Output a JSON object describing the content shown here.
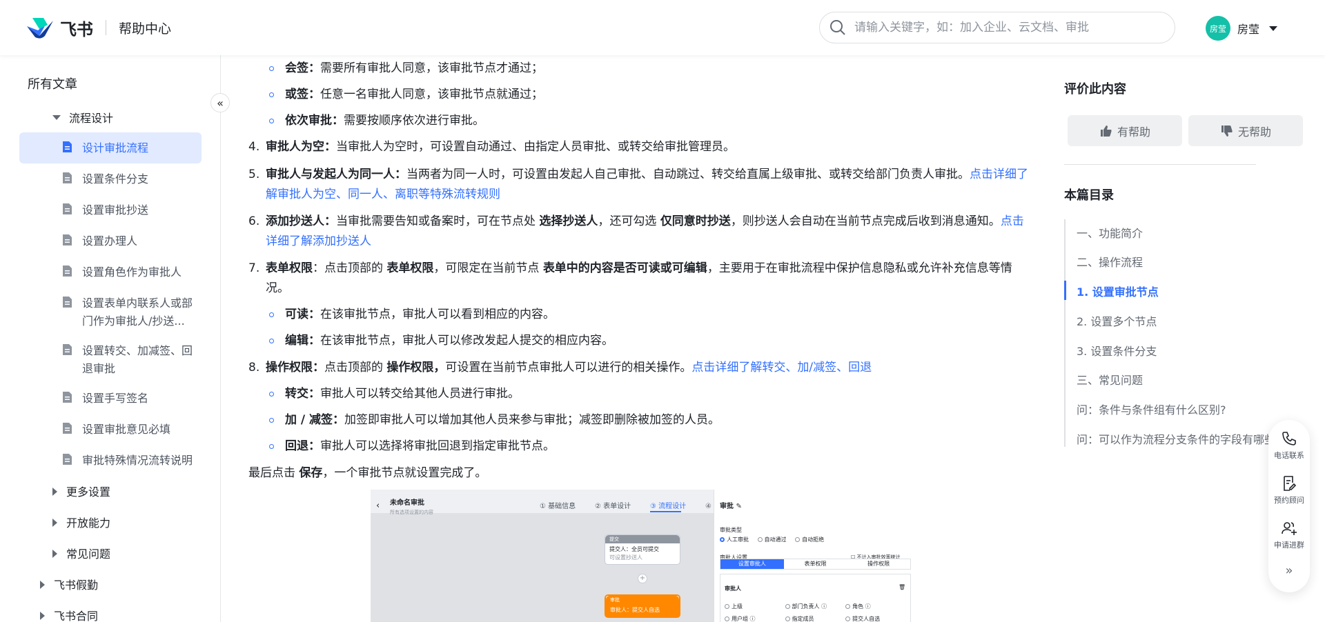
{
  "header": {
    "brand": "飞书",
    "help_center": "帮助中心",
    "search_placeholder": "请输入关键字，如：加入企业、云文档、审批",
    "user": {
      "avatar_text": "房莹",
      "name": "房莹"
    }
  },
  "sidebar": {
    "title": "所有文章",
    "expanded_section": "流程设计",
    "docs": [
      "设计审批流程",
      "设置条件分支",
      "设置审批抄送",
      "设置办理人",
      "设置角色作为审批人",
      "设置表单内联系人或部门作为审批人/抄送...",
      "设置转交、加减签、回退审批",
      "设置手写签名",
      "设置审批意见必填",
      "审批特殊情况流转说明"
    ],
    "collapsed_sections": [
      "更多设置",
      "开放能力",
      "常见问题"
    ],
    "top_sections": [
      "飞书假勤",
      "飞书合同"
    ],
    "collapse_icon": "«"
  },
  "article": {
    "b1": {
      "bold": "会签：",
      "text": "需要所有审批人同意，该审批节点才通过；"
    },
    "b2": {
      "bold": "或签：",
      "text": "任意一名审批人同意，该审批节点就通过；"
    },
    "b3": {
      "bold": "依次审批：",
      "text": "需要按顺序依次进行审批。"
    },
    "i4": {
      "num": "4.",
      "bold": "审批人为空：",
      "text": "当审批人为空时，可设置自动通过、由指定人员审批、或转交给审批管理员。"
    },
    "i5": {
      "num": "5.",
      "bold": "审批人与发起人为同一人：",
      "text": "当两者为同一人时，可设置由发起人自己审批、自动跳过、转交给直属上级审批、或转交给部门负责人审批。",
      "link": "点击详细了解审批人为空、同一人、离职等特殊流转规则"
    },
    "i6": {
      "num": "6.",
      "bold": "添加抄送人：",
      "t1": "当审批需要告知或备案时，可在节点处 ",
      "b2": "选择抄送人",
      "t2": "，还可勾选 ",
      "b3": "仅同意时抄送",
      "t3": "，则抄送人会自动在当前节点完成后收到消息通知。",
      "link": "点击详细了解添加抄送人"
    },
    "i7": {
      "num": "7.",
      "bold": "表单权限",
      "t1": "：点击顶部的 ",
      "b2": "表单权限",
      "t2": "，可限定在当前节点 ",
      "b3": "表单中的内容是否可读或可编辑",
      "t3": "，主要用于在审批流程中保护信息隐私或允许补充信息等情况。"
    },
    "b7a": {
      "bold": "可读：",
      "text": "在该审批节点，审批人可以看到相应的内容。"
    },
    "b7b": {
      "bold": "编辑：",
      "text": "在该审批节点，审批人可以修改发起人提交的相应内容。"
    },
    "i8": {
      "num": "8.",
      "bold": "操作权限：",
      "t1": "点击顶部的 ",
      "b2": "操作权限，",
      "t2": "可设置在当前节点审批人可以进行的相关操作。",
      "link": "点击详细了解转交、加/减签、回退"
    },
    "b8a": {
      "bold": "转交：",
      "text": "审批人可以转交给其他人员进行审批。"
    },
    "b8b": {
      "bold": "加 / 减签：",
      "text": "加签即审批人可以增加其他人员来参与审批；减签即删除被加签的人员。"
    },
    "b8c": {
      "bold": "回退：",
      "text": "审批人可以选择将审批回退到指定审批节点。"
    },
    "final": {
      "t1": "最后点击 ",
      "bold": "保存",
      "t2": "，一个审批节点就设置完成了。"
    }
  },
  "screenshot": {
    "back_icon": "‹",
    "title": "未命名审批",
    "subtitle": "所有选项设置的内容",
    "steps": [
      "① 基础信息",
      "② 表单设计",
      "③ 流程设计",
      "④"
    ],
    "node1_head": "提交",
    "node1_line1": "提交人：全员可提交",
    "node1_line2": "可设置抄送人",
    "plus": "+",
    "node2_head": "审批",
    "node2_line1": "审批人：提交人自选",
    "panel_title": "审批 ✎",
    "approval_type": "审批类型",
    "type_options": [
      "人工审批",
      "自动通过",
      "自动拒绝"
    ],
    "approver_setting": "审批人设置",
    "efficiency": "不计入审批效率统计",
    "tabs": [
      "设置审批人",
      "表单权限",
      "操作权限"
    ],
    "box_title": "审批人",
    "opts_row1": [
      "上级",
      "部门负责人 ⓘ",
      "角色 ⓘ"
    ],
    "opts_row2": [
      "用户组 ⓘ",
      "指定成员",
      "提交人自选"
    ]
  },
  "right_panel": {
    "rate_title": "评价此内容",
    "helpful": "有帮助",
    "not_helpful": "无帮助",
    "toc_title": "本篇目录",
    "toc": [
      "一、功能简介",
      "二、操作流程",
      "1. 设置审批节点",
      "2. 设置多个节点",
      "3. 设置条件分支",
      "三、常见问题",
      "问：条件与条件组有什么区别?",
      "问：可以作为流程分支条件的字段有哪些"
    ],
    "toc_active_index": 2
  },
  "float_widget": {
    "phone": "电话联系",
    "consult": "预约顾问",
    "group": "申请进群",
    "more": "»"
  },
  "colors": {
    "accent": "#3370ff",
    "active_bg": "#e1eaff",
    "avatar": "#14c0a8",
    "node_orange": "#ff8800"
  }
}
